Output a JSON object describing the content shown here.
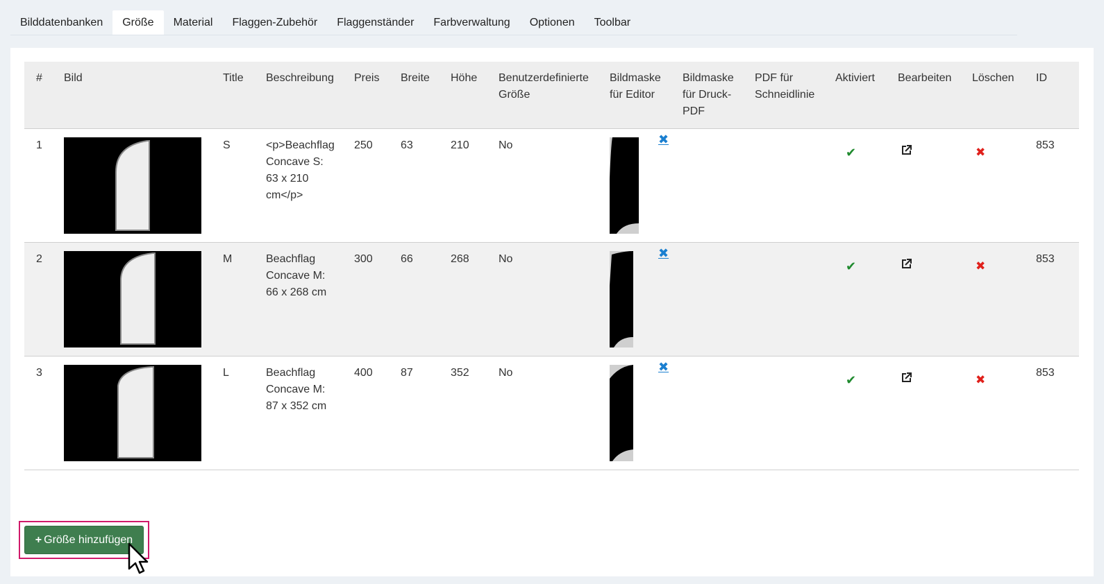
{
  "tabs": [
    {
      "label": "Bilddatenbanken",
      "active": false
    },
    {
      "label": "Größe",
      "active": true
    },
    {
      "label": "Material",
      "active": false
    },
    {
      "label": "Flaggen-Zubehör",
      "active": false
    },
    {
      "label": "Flaggenständer",
      "active": false
    },
    {
      "label": "Farbverwaltung",
      "active": false
    },
    {
      "label": "Optionen",
      "active": false
    },
    {
      "label": "Toolbar",
      "active": false
    }
  ],
  "table": {
    "headers": {
      "num": "#",
      "image": "Bild",
      "title": "Title",
      "description": "Beschreibung",
      "price": "Preis",
      "width": "Breite",
      "height": "Höhe",
      "custom_size": "Benutzerdefinierte Größe",
      "mask_editor": "Bildmaske für Editor",
      "mask_print": "Bildmaske für Druck-PDF",
      "pdf_cutline": "PDF für Schneidlinie",
      "active": "Aktiviert",
      "edit": "Bearbeiten",
      "delete": "Löschen",
      "id": "ID"
    },
    "rows": [
      {
        "num": "1",
        "title": "S",
        "description": "<p>Beachflag Concave S: 63 x 210 cm</p>",
        "price": "250",
        "width": "63",
        "height": "210",
        "custom_size": "No",
        "remove_mask": "✖",
        "id": "853"
      },
      {
        "num": "2",
        "title": "M",
        "description": "Beachflag Concave M: 66 x 268 cm",
        "price": "300",
        "width": "66",
        "height": "268",
        "custom_size": "No",
        "remove_mask": "✖",
        "id": "853"
      },
      {
        "num": "3",
        "title": "L",
        "description": "Beachflag Concave M: 87 x 352 cm",
        "price": "400",
        "width": "87",
        "height": "352",
        "custom_size": "No",
        "remove_mask": "✖",
        "id": "853"
      }
    ]
  },
  "icons": {
    "active": "check-icon",
    "edit": "external-link-icon",
    "delete": "close-icon"
  },
  "add_button": {
    "plus": "+",
    "label": "Größe hinzufügen"
  },
  "colors": {
    "button_bg": "#3f7e4f",
    "highlight_frame": "#d0196a",
    "check": "#1f8a2e",
    "delete": "#e0201b",
    "remove_link": "#1a7fd0"
  }
}
